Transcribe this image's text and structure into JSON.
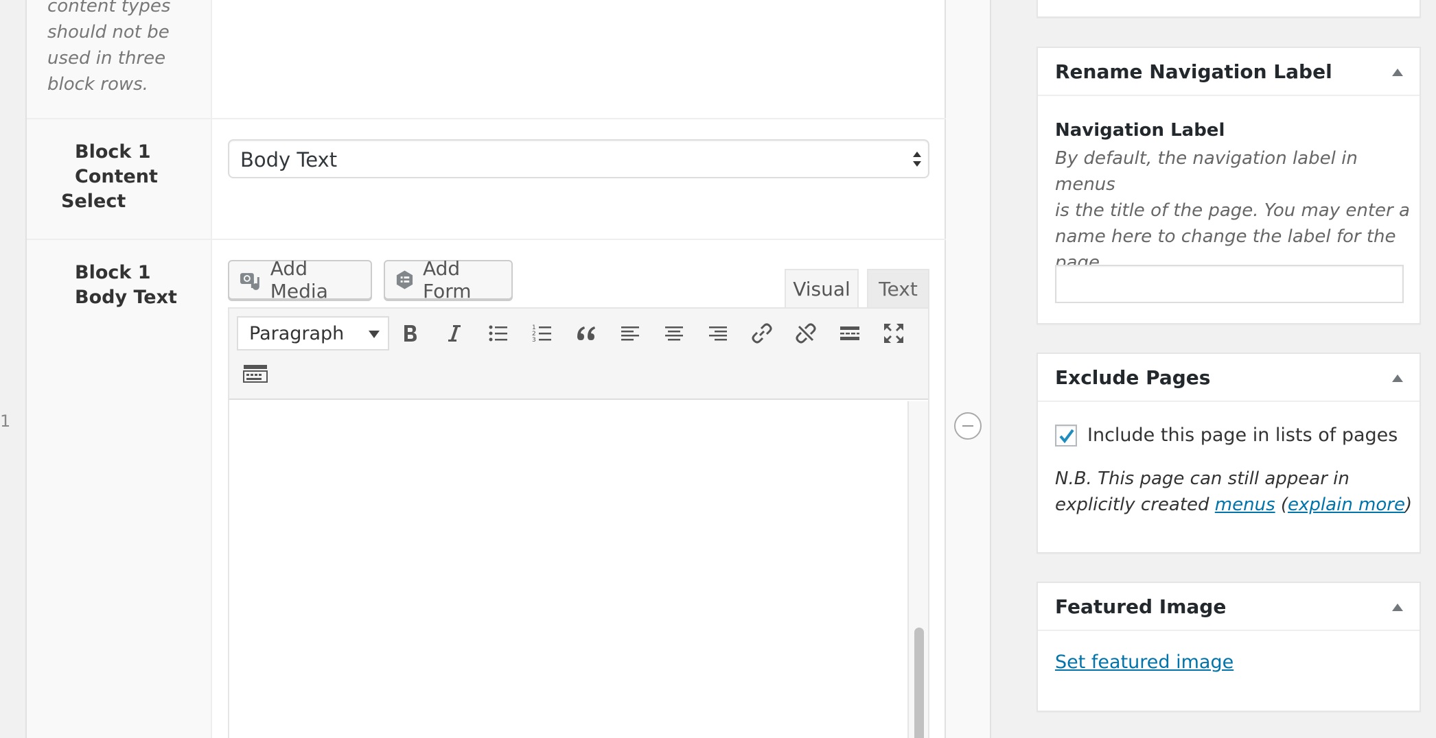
{
  "row_number": "1",
  "left_panel": {
    "description_lines": [
      "content types",
      "should not be",
      "used in three",
      "block rows."
    ],
    "fields": [
      {
        "label_lines": [
          "Block 1",
          "Content",
          "Select"
        ]
      },
      {
        "label_lines": [
          "Block 1",
          "Body Text"
        ]
      }
    ]
  },
  "content_select": {
    "value": "Body Text"
  },
  "media_buttons": {
    "add_media": "Add Media",
    "add_form": "Add Form"
  },
  "editor_tabs": {
    "visual": "Visual",
    "text": "Text"
  },
  "toolbar": {
    "format_value": "Paragraph",
    "icons": [
      "bold-icon",
      "italic-icon",
      "bulleted-list-icon",
      "numbered-list-icon",
      "blockquote-icon",
      "align-left-icon",
      "align-center-icon",
      "align-right-icon",
      "insert-link-icon",
      "remove-link-icon",
      "read-more-icon",
      "fullscreen-icon",
      "toolbar-toggle-icon"
    ]
  },
  "sidebar": {
    "rename_nav": {
      "title": "Rename Navigation Label",
      "field_label": "Navigation Label",
      "description_lines": [
        "By default, the navigation label in menus",
        "is the title of the page. You may enter a",
        "name here to change the label for the",
        "page."
      ],
      "input_value": ""
    },
    "exclude_pages": {
      "title": "Exclude Pages",
      "checkbox_label": "Include this page in lists of pages",
      "checked": true,
      "note_line1": "N.B. This page can still appear in",
      "note_line2_prefix": "explicitly created ",
      "menus_link": "menus",
      "open_paren": " (",
      "explain_link": "explain more",
      "close_paren": ")"
    },
    "featured_image": {
      "title": "Featured Image",
      "link": "Set featured image"
    }
  },
  "colors": {
    "link": "#0073aa",
    "checkmark": "#1e8cbe",
    "border": "#e5e5e5"
  }
}
